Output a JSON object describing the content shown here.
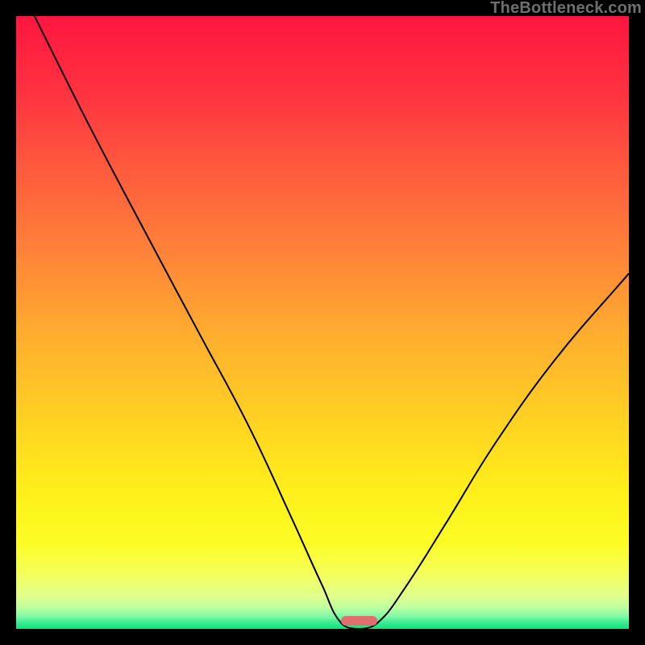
{
  "watermark": "TheBottleneck.com",
  "colors": {
    "bg_black": "#000000",
    "curve": "#000000",
    "marker": "#e07070",
    "gradient_stops": [
      {
        "offset": 0.0,
        "color": "#ff163f"
      },
      {
        "offset": 0.12,
        "color": "#ff3140"
      },
      {
        "offset": 0.25,
        "color": "#ff5a3e"
      },
      {
        "offset": 0.38,
        "color": "#ff8139"
      },
      {
        "offset": 0.52,
        "color": "#ffad2f"
      },
      {
        "offset": 0.66,
        "color": "#ffd222"
      },
      {
        "offset": 0.78,
        "color": "#fff01a"
      },
      {
        "offset": 0.86,
        "color": "#fcfd25"
      },
      {
        "offset": 0.91,
        "color": "#f4ff5a"
      },
      {
        "offset": 0.945,
        "color": "#e2ff8a"
      },
      {
        "offset": 0.965,
        "color": "#c0ffa0"
      },
      {
        "offset": 0.98,
        "color": "#7cf9a6"
      },
      {
        "offset": 0.992,
        "color": "#2fe98d"
      },
      {
        "offset": 1.0,
        "color": "#14e07a"
      }
    ]
  },
  "chart_data": {
    "type": "line",
    "title": "",
    "xlabel": "",
    "ylabel": "",
    "xlim": [
      0,
      100
    ],
    "ylim": [
      0,
      100
    ],
    "series": [
      {
        "name": "bottleneck-curve",
        "points": [
          {
            "x": 3,
            "y": 100
          },
          {
            "x": 12,
            "y": 82
          },
          {
            "x": 22,
            "y": 63
          },
          {
            "x": 30,
            "y": 48
          },
          {
            "x": 38,
            "y": 33
          },
          {
            "x": 45,
            "y": 18
          },
          {
            "x": 50,
            "y": 7
          },
          {
            "x": 53,
            "y": 1
          },
          {
            "x": 56,
            "y": 0
          },
          {
            "x": 59,
            "y": 1
          },
          {
            "x": 63,
            "y": 6
          },
          {
            "x": 70,
            "y": 17
          },
          {
            "x": 78,
            "y": 30
          },
          {
            "x": 88,
            "y": 44
          },
          {
            "x": 100,
            "y": 58
          }
        ]
      }
    ],
    "marker": {
      "x_center": 56,
      "width_pct": 6,
      "y": 0
    },
    "notes": "V-shaped curve: descends steeply from top-left to a minimum near x≈56, then rises toward the right. Background is a vertical heat gradient from red (top) through orange/yellow to green (bottom). Values are visual estimates on a 0–100 normalized range since no axes/ticks are present."
  }
}
